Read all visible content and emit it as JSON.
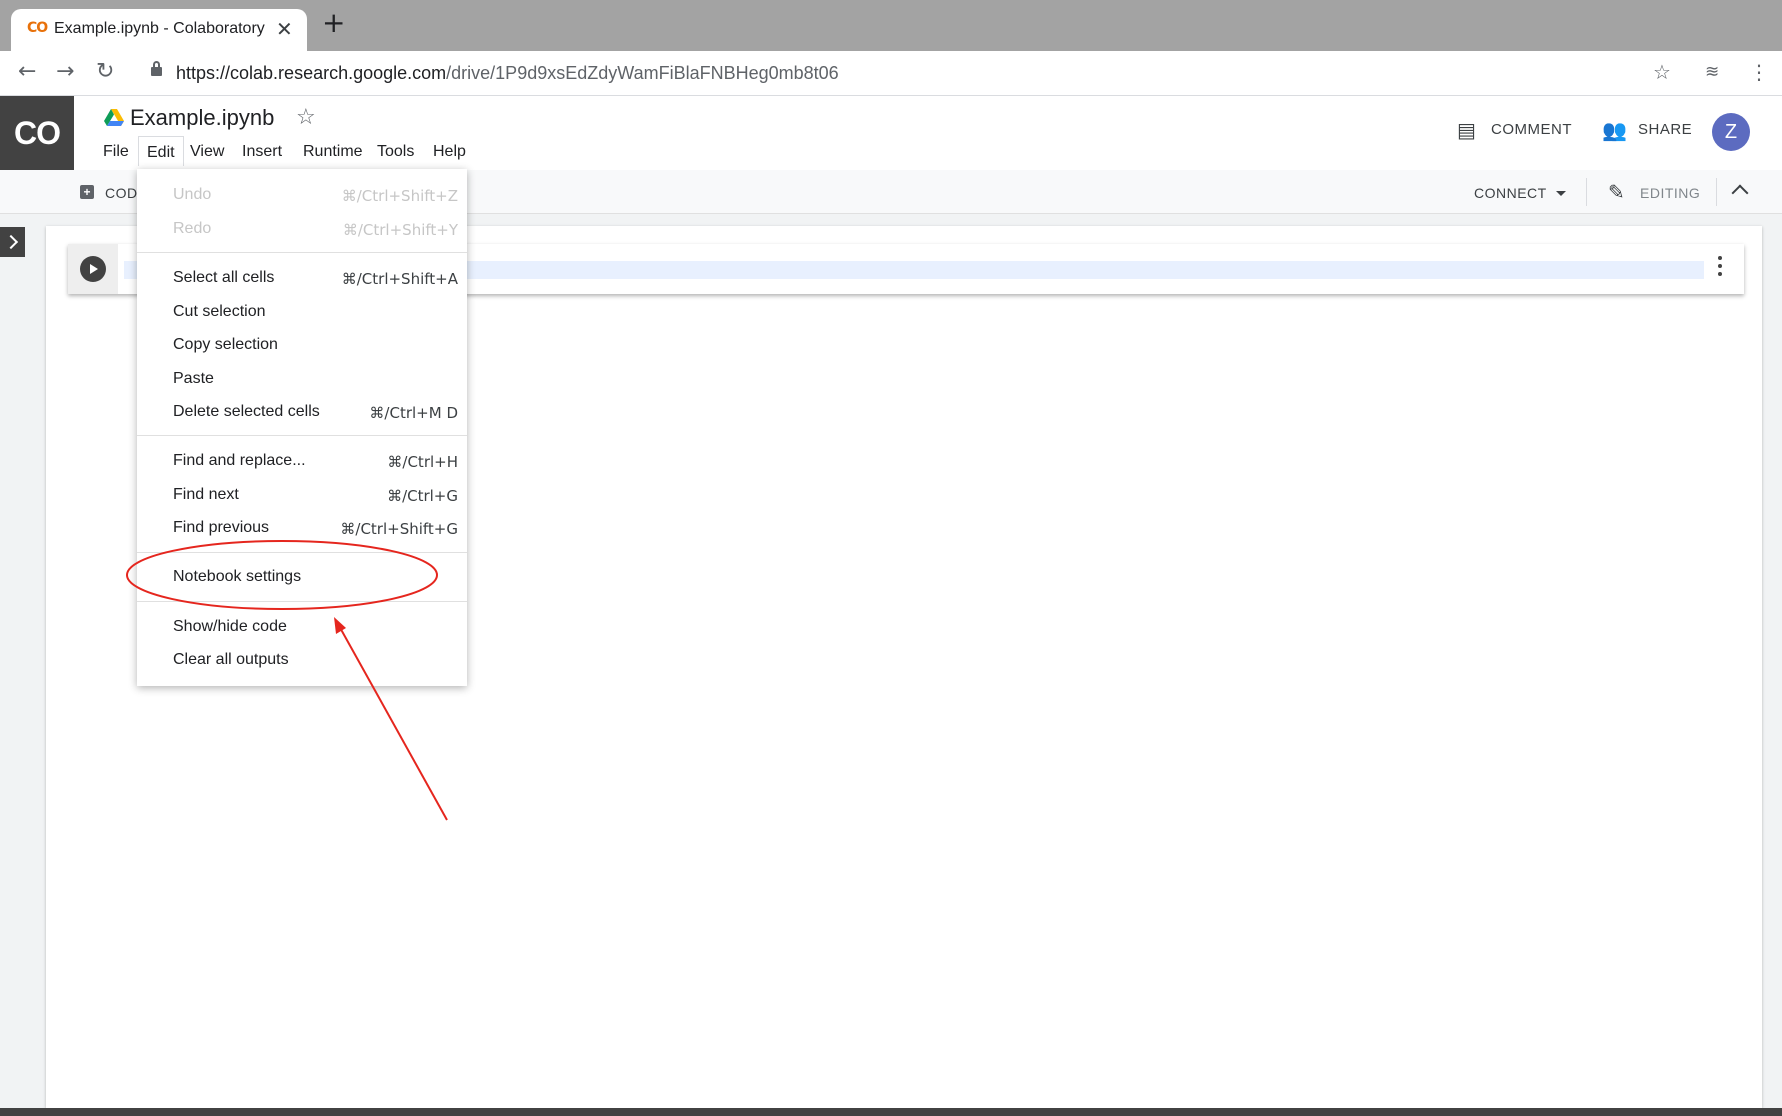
{
  "browser": {
    "tab_title": "Example.ipynb - Colaboratory",
    "tab_favicon": "CO",
    "url_host": "https://colab.research.google.com",
    "url_path": "/drive/1P9d9xsEdZdyWamFiBlaFNBHeg0mb8t06",
    "icons": [
      "back-icon",
      "forward-icon",
      "reload-icon",
      "lock-icon",
      "bookmark-star-icon",
      "extension-icon",
      "more-icon"
    ]
  },
  "header": {
    "logo": "CO",
    "notebook_title": "Example.ipynb",
    "menu": [
      "File",
      "Edit",
      "View",
      "Insert",
      "Runtime",
      "Tools",
      "Help"
    ],
    "active_menu": "Edit",
    "comment_label": "COMMENT",
    "share_label": "SHARE",
    "avatar_initial": "Z"
  },
  "toolbar": {
    "code_label": "COD",
    "connect_label": "CONNECT",
    "editing_label": "EDITING"
  },
  "edit_menu": {
    "groups": [
      [
        {
          "label": "Undo",
          "shortcut": "⌘/Ctrl+Shift+Z",
          "disabled": true
        },
        {
          "label": "Redo",
          "shortcut": "⌘/Ctrl+Shift+Y",
          "disabled": true
        }
      ],
      [
        {
          "label": "Select all cells",
          "shortcut": "⌘/Ctrl+Shift+A",
          "disabled": false
        },
        {
          "label": "Cut selection",
          "shortcut": "",
          "disabled": false
        },
        {
          "label": "Copy selection",
          "shortcut": "",
          "disabled": false
        },
        {
          "label": "Paste",
          "shortcut": "",
          "disabled": false
        },
        {
          "label": "Delete selected cells",
          "shortcut": "⌘/Ctrl+M D",
          "disabled": false
        }
      ],
      [
        {
          "label": "Find and replace...",
          "shortcut": "⌘/Ctrl+H",
          "disabled": false
        },
        {
          "label": "Find next",
          "shortcut": "⌘/Ctrl+G",
          "disabled": false
        },
        {
          "label": "Find previous",
          "shortcut": "⌘/Ctrl+Shift+G",
          "disabled": false
        }
      ],
      [
        {
          "label": "Notebook settings",
          "shortcut": "",
          "disabled": false
        }
      ],
      [
        {
          "label": "Show/hide code",
          "shortcut": "",
          "disabled": false
        },
        {
          "label": "Clear all outputs",
          "shortcut": "",
          "disabled": false
        }
      ]
    ]
  },
  "annotation": {
    "color": "#e5261e",
    "highlighted_item": "Notebook settings"
  },
  "colors": {
    "logo_bg": "#424242",
    "avatar_bg": "#5c6bc0",
    "tab_strip": "#a3a3a3",
    "cell_editor": "#e8f0fe"
  }
}
